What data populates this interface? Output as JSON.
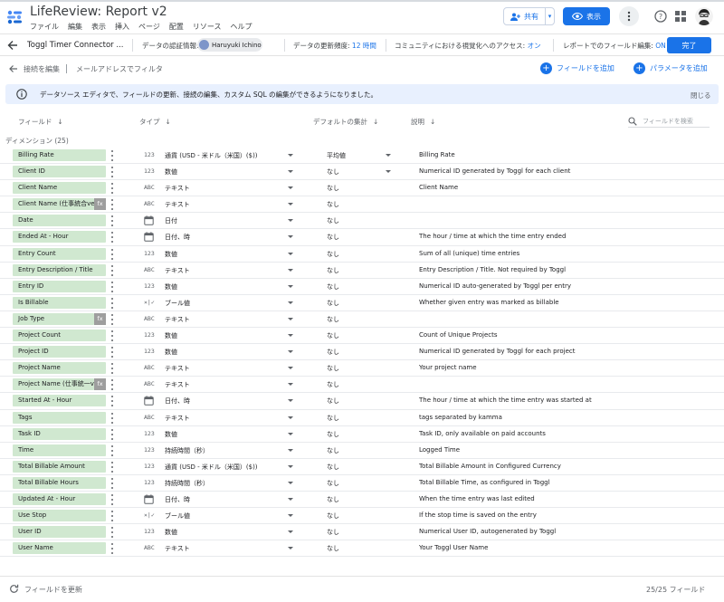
{
  "app": {
    "title": "LifeReview: Report v2",
    "menu": [
      "ファイル",
      "編集",
      "表示",
      "挿入",
      "ページ",
      "配置",
      "リソース",
      "ヘルプ"
    ],
    "share_label": "共有",
    "view_label": "表示"
  },
  "connector": {
    "name": "Toggl Timer Connector ...",
    "credentials_label": "データの認証情報:",
    "credentials_user": "Haruyuki Ichino",
    "freshness_label": "データの更新頻度:",
    "freshness_value": "12 時間",
    "community_label": "コミュニティにおける視覚化へのアクセス:",
    "community_value": "オン",
    "field_edit_label": "レポートでのフィールド編集:",
    "field_edit_value": "ON",
    "done_label": "完了"
  },
  "toolbar": {
    "edit_connection": "接続を編集",
    "filter_by_email": "メールアドレスでフィルタ",
    "add_field": "フィールドを追加",
    "add_parameter": "パラメータを追加"
  },
  "banner": {
    "text": "データソース エディタで、フィールドの更新、接続の編集、カスタム SQL の編集ができるようになりました。",
    "close": "閉じる"
  },
  "columns": {
    "field": "フィールド",
    "type": "タイプ",
    "default_agg": "デフォルトの集計",
    "description": "説明",
    "search_placeholder": "フィールドを検索"
  },
  "group": {
    "label": "ディメンション (25)"
  },
  "fields": [
    {
      "name": "Billing Rate",
      "calc": false,
      "type_icon": "123",
      "type": "通貨 (USD - 米ドル（米国）($))",
      "agg": "平均値",
      "agg_caret": true,
      "desc": "Billing Rate"
    },
    {
      "name": "Client ID",
      "calc": false,
      "type_icon": "123",
      "type": "数値",
      "agg": "なし",
      "agg_caret": true,
      "desc": "Numerical ID generated by Toggl for each client"
    },
    {
      "name": "Client Name",
      "calc": false,
      "type_icon": "ABC",
      "type": "テキスト",
      "agg": "なし",
      "agg_caret": false,
      "desc": "Client Name"
    },
    {
      "name": "Client Name (仕事統合ver)",
      "calc": true,
      "type_icon": "ABC",
      "type": "テキスト",
      "agg": "なし",
      "agg_caret": false,
      "desc": ""
    },
    {
      "name": "Date",
      "calc": false,
      "type_icon": "calendar",
      "type": "日付",
      "agg": "なし",
      "agg_caret": false,
      "desc": ""
    },
    {
      "name": "Ended At - Hour",
      "calc": false,
      "type_icon": "calendar",
      "type": "日付、時",
      "agg": "なし",
      "agg_caret": false,
      "desc": "The hour / time at which the time entry ended"
    },
    {
      "name": "Entry Count",
      "calc": false,
      "type_icon": "123",
      "type": "数値",
      "agg": "なし",
      "agg_caret": false,
      "desc": "Sum of all (unique) time entries"
    },
    {
      "name": "Entry Description / Title",
      "calc": false,
      "type_icon": "ABC",
      "type": "テキスト",
      "agg": "なし",
      "agg_caret": false,
      "desc": "Entry Description / Title. Not required by Toggl"
    },
    {
      "name": "Entry ID",
      "calc": false,
      "type_icon": "123",
      "type": "数値",
      "agg": "なし",
      "agg_caret": false,
      "desc": "Numerical ID auto-generated by Toggl per entry"
    },
    {
      "name": "Is Billable",
      "calc": false,
      "type_icon": "bool",
      "type": "ブール値",
      "agg": "なし",
      "agg_caret": false,
      "desc": "Whether given entry was marked as billable"
    },
    {
      "name": "Job Type",
      "calc": true,
      "type_icon": "ABC",
      "type": "テキスト",
      "agg": "なし",
      "agg_caret": false,
      "desc": ""
    },
    {
      "name": "Project Count",
      "calc": false,
      "type_icon": "123",
      "type": "数値",
      "agg": "なし",
      "agg_caret": false,
      "desc": "Count of Unique Projects"
    },
    {
      "name": "Project ID",
      "calc": false,
      "type_icon": "123",
      "type": "数値",
      "agg": "なし",
      "agg_caret": false,
      "desc": "Numerical ID generated by Toggl for each project"
    },
    {
      "name": "Project Name",
      "calc": false,
      "type_icon": "ABC",
      "type": "テキスト",
      "agg": "なし",
      "agg_caret": false,
      "desc": "Your project name"
    },
    {
      "name": "Project Name (仕事統一v...",
      "calc": true,
      "type_icon": "ABC",
      "type": "テキスト",
      "agg": "なし",
      "agg_caret": false,
      "desc": ""
    },
    {
      "name": "Started At - Hour",
      "calc": false,
      "type_icon": "calendar",
      "type": "日付、時",
      "agg": "なし",
      "agg_caret": false,
      "desc": "The hour / time at which the time entry was started at"
    },
    {
      "name": "Tags",
      "calc": false,
      "type_icon": "ABC",
      "type": "テキスト",
      "agg": "なし",
      "agg_caret": false,
      "desc": "tags separated by kamma"
    },
    {
      "name": "Task ID",
      "calc": false,
      "type_icon": "123",
      "type": "数値",
      "agg": "なし",
      "agg_caret": false,
      "desc": "Task ID, only available on paid accounts"
    },
    {
      "name": "Time",
      "calc": false,
      "type_icon": "123",
      "type": "持続時間（秒）",
      "agg": "なし",
      "agg_caret": false,
      "desc": "Logged Time"
    },
    {
      "name": "Total Billable Amount",
      "calc": false,
      "type_icon": "123",
      "type": "通貨 (USD - 米ドル（米国）($))",
      "agg": "なし",
      "agg_caret": false,
      "desc": "Total Billable Amount in Configured Currency"
    },
    {
      "name": "Total Billable Hours",
      "calc": false,
      "type_icon": "123",
      "type": "持続時間（秒）",
      "agg": "なし",
      "agg_caret": false,
      "desc": "Total Billable Time, as configured in Toggl"
    },
    {
      "name": "Updated At - Hour",
      "calc": false,
      "type_icon": "calendar",
      "type": "日付、時",
      "agg": "なし",
      "agg_caret": false,
      "desc": "When the time entry was last edited"
    },
    {
      "name": "Use Stop",
      "calc": false,
      "type_icon": "bool",
      "type": "ブール値",
      "agg": "なし",
      "agg_caret": false,
      "desc": "If the stop time is saved on the entry"
    },
    {
      "name": "User ID",
      "calc": false,
      "type_icon": "123",
      "type": "数値",
      "agg": "なし",
      "agg_caret": false,
      "desc": "Numerical User ID, autogenerated by Toggl"
    },
    {
      "name": "User Name",
      "calc": false,
      "type_icon": "ABC",
      "type": "テキスト",
      "agg": "なし",
      "agg_caret": false,
      "desc": "Your Toggl User Name"
    }
  ],
  "footer": {
    "refresh_label": "フィールドを更新",
    "count_label": "25/25 フィールド"
  },
  "colors": {
    "accent": "#1a73e8",
    "field_chip": "#d0e8d0",
    "banner_bg": "#e8f0fe"
  }
}
